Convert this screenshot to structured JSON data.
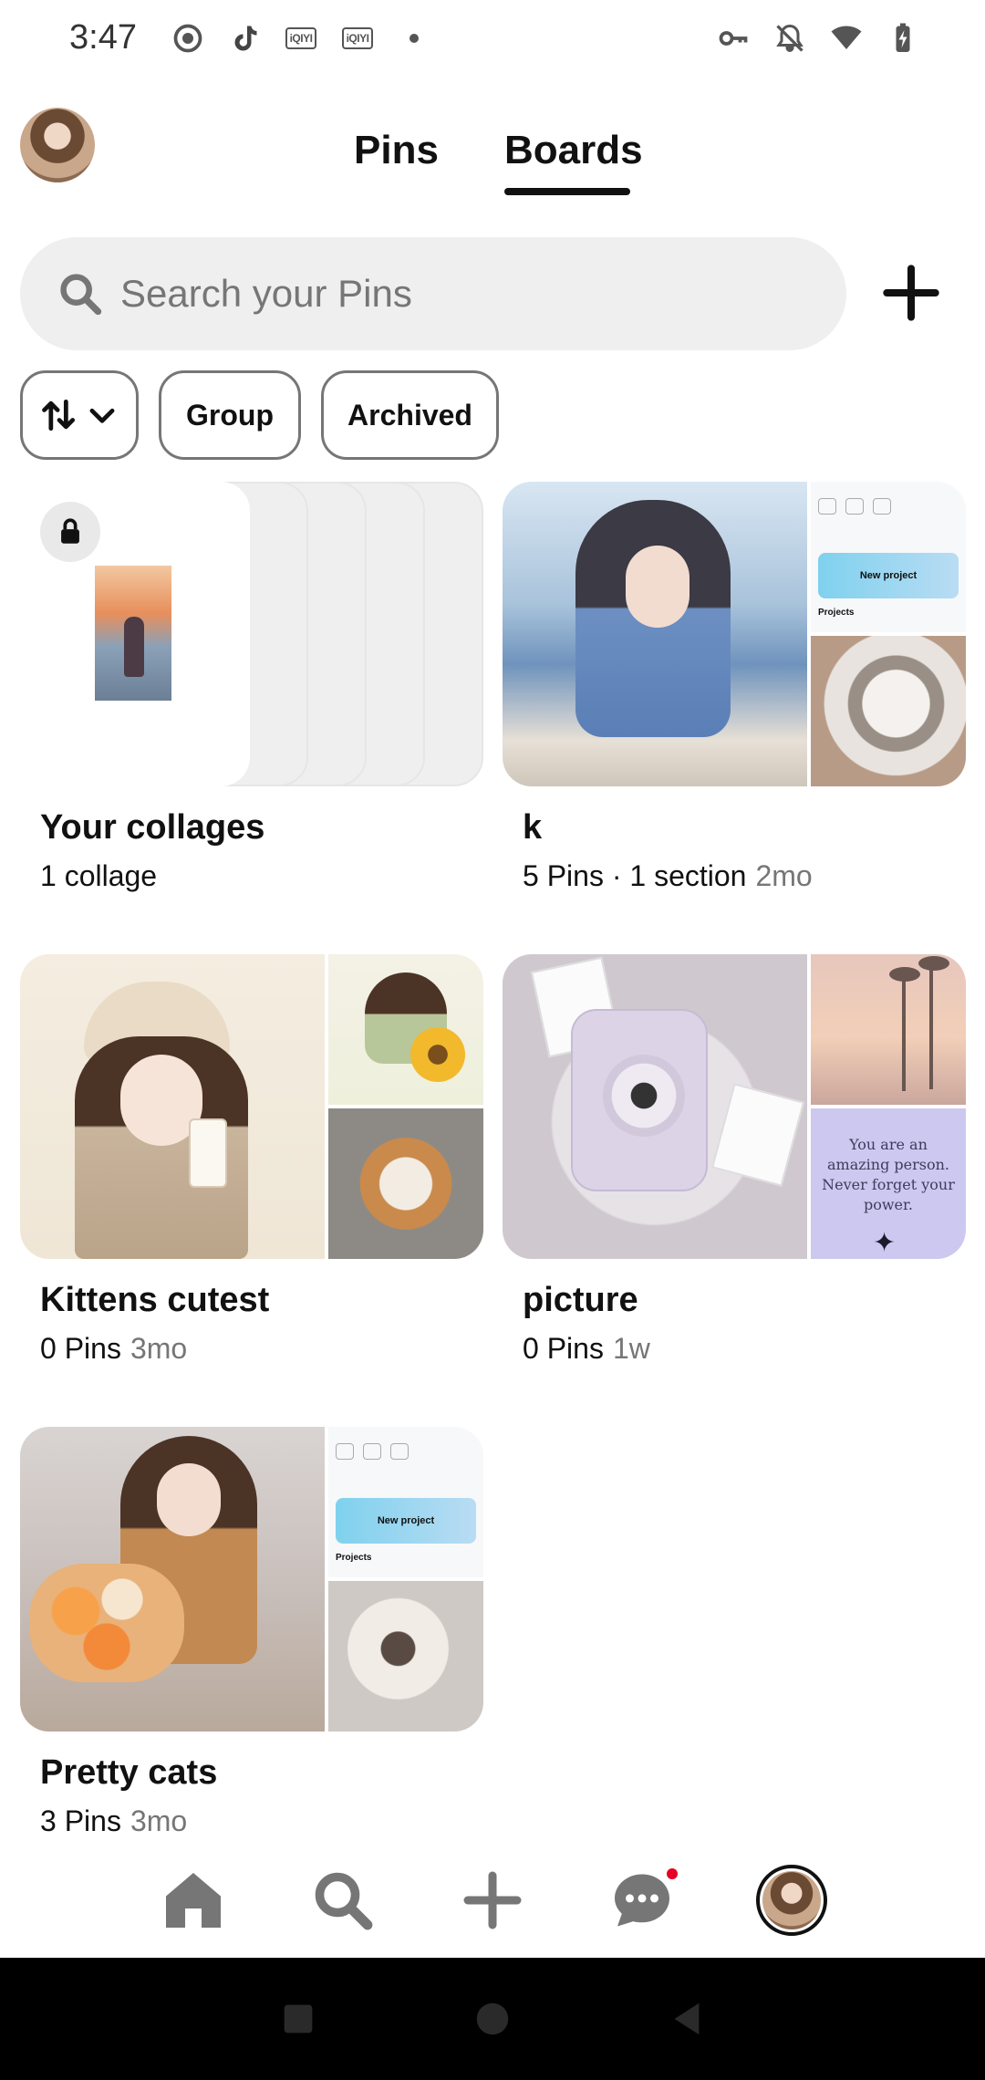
{
  "status_bar": {
    "time": "3:47",
    "left_icons": [
      "record-icon",
      "tiktok-icon",
      "iqiyi-icon",
      "iqiyi-icon",
      "dot-icon"
    ],
    "iqiyi_label": "iQIYI",
    "right_icons": [
      "vpn-key-icon",
      "bell-off-icon",
      "wifi-icon",
      "battery-charging-icon"
    ]
  },
  "header": {
    "tabs": [
      {
        "label": "Pins",
        "active": false
      },
      {
        "label": "Boards",
        "active": true
      }
    ]
  },
  "search": {
    "placeholder": "Search your Pins"
  },
  "filters": {
    "sort_icon": "sort-arrows-icon",
    "chips": [
      {
        "label": "Group"
      },
      {
        "label": "Archived"
      }
    ]
  },
  "boards": [
    {
      "title": "Your collages",
      "meta": "1 collage",
      "age": "",
      "locked": true
    },
    {
      "title": "k",
      "meta": "5 Pins · 1 section",
      "age": "2mo"
    },
    {
      "title": "Kittens cutest",
      "meta": "0 Pins",
      "age": "3mo"
    },
    {
      "title": "picture",
      "meta": "0 Pins",
      "age": "1w"
    },
    {
      "title": "Pretty cats",
      "meta": "3 Pins",
      "age": "3mo"
    }
  ],
  "cover_texts": {
    "quote_lines": [
      "You are an",
      "amazing person.",
      "Never forget your",
      "power."
    ],
    "new_project": "New project",
    "projects": "Projects"
  },
  "bottom_nav": {
    "items": [
      "home-icon",
      "search-icon",
      "create-icon",
      "messages-icon",
      "profile-avatar"
    ]
  },
  "colors": {
    "accent": "#e60023",
    "text": "#111111",
    "muted": "#767676",
    "search_bg": "#efefef"
  }
}
